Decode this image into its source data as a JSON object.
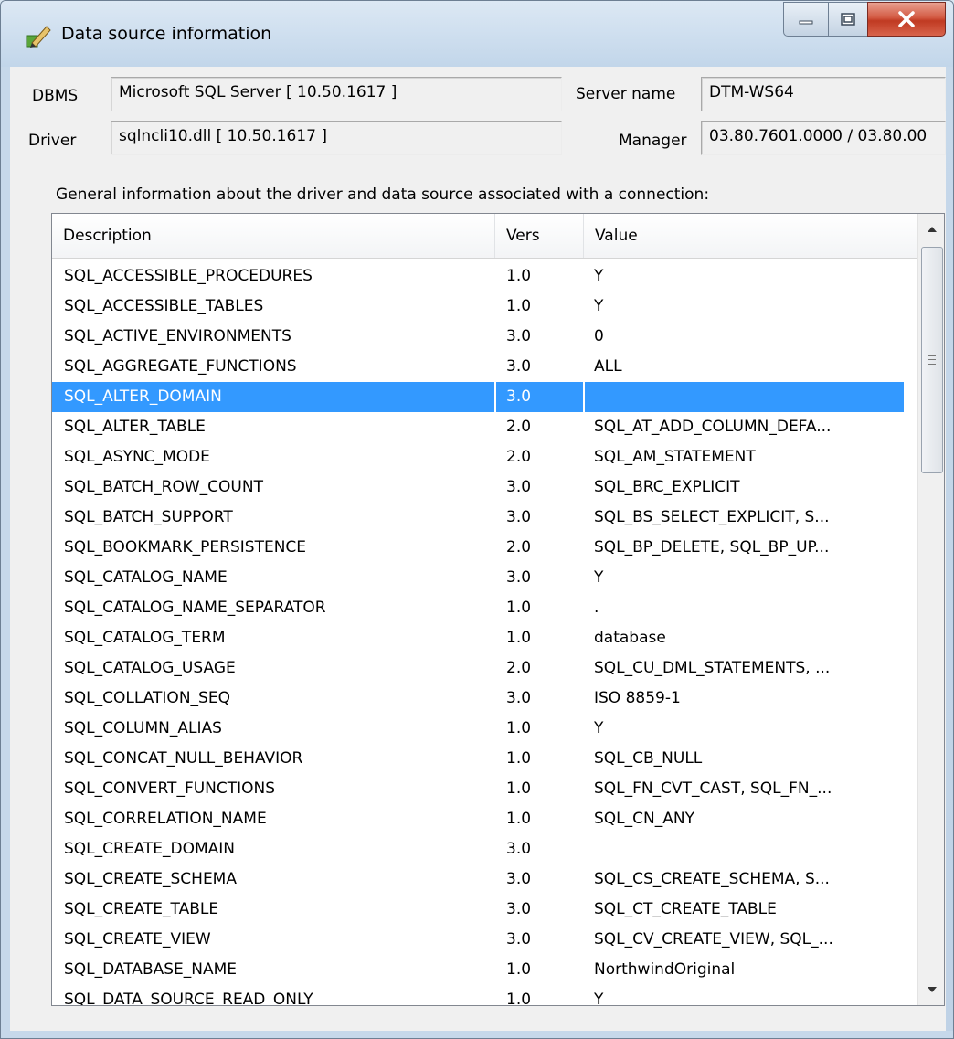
{
  "window": {
    "title": "Data source information",
    "buttons": {
      "minimize": "minimize",
      "maximize": "restore",
      "close": "close"
    }
  },
  "info": {
    "dbms_label": "DBMS",
    "dbms_value": "Microsoft SQL Server [ 10.50.1617 ]",
    "driver_label": "Driver",
    "driver_value": "sqlncli10.dll [ 10.50.1617 ]",
    "server_label": "Server name",
    "server_value": "DTM-WS64",
    "manager_label": "Manager",
    "manager_value": "03.80.7601.0000 / 03.80.00"
  },
  "list": {
    "caption": "General information about the driver and data source associated with a connection:",
    "columns": {
      "description": "Description",
      "vers": "Vers",
      "value": "Value"
    },
    "selected_index": 4,
    "rows": [
      {
        "description": "SQL_ACCESSIBLE_PROCEDURES",
        "vers": "1.0",
        "value": "Y"
      },
      {
        "description": "SQL_ACCESSIBLE_TABLES",
        "vers": "1.0",
        "value": "Y"
      },
      {
        "description": "SQL_ACTIVE_ENVIRONMENTS",
        "vers": "3.0",
        "value": "0"
      },
      {
        "description": "SQL_AGGREGATE_FUNCTIONS",
        "vers": "3.0",
        "value": "ALL"
      },
      {
        "description": "SQL_ALTER_DOMAIN",
        "vers": "3.0",
        "value": ""
      },
      {
        "description": "SQL_ALTER_TABLE",
        "vers": "2.0",
        "value": "SQL_AT_ADD_COLUMN_DEFA..."
      },
      {
        "description": "SQL_ASYNC_MODE",
        "vers": "2.0",
        "value": "SQL_AM_STATEMENT"
      },
      {
        "description": "SQL_BATCH_ROW_COUNT",
        "vers": "3.0",
        "value": "SQL_BRC_EXPLICIT"
      },
      {
        "description": "SQL_BATCH_SUPPORT",
        "vers": "3.0",
        "value": "SQL_BS_SELECT_EXPLICIT, S..."
      },
      {
        "description": "SQL_BOOKMARK_PERSISTENCE",
        "vers": "2.0",
        "value": "SQL_BP_DELETE, SQL_BP_UP..."
      },
      {
        "description": "SQL_CATALOG_NAME",
        "vers": "3.0",
        "value": "Y"
      },
      {
        "description": "SQL_CATALOG_NAME_SEPARATOR",
        "vers": "1.0",
        "value": "."
      },
      {
        "description": "SQL_CATALOG_TERM",
        "vers": "1.0",
        "value": "database"
      },
      {
        "description": "SQL_CATALOG_USAGE",
        "vers": "2.0",
        "value": "SQL_CU_DML_STATEMENTS, ..."
      },
      {
        "description": "SQL_COLLATION_SEQ",
        "vers": "3.0",
        "value": "ISO 8859-1"
      },
      {
        "description": "SQL_COLUMN_ALIAS",
        "vers": "1.0",
        "value": "Y"
      },
      {
        "description": "SQL_CONCAT_NULL_BEHAVIOR",
        "vers": "1.0",
        "value": "SQL_CB_NULL"
      },
      {
        "description": "SQL_CONVERT_FUNCTIONS",
        "vers": "1.0",
        "value": "SQL_FN_CVT_CAST, SQL_FN_..."
      },
      {
        "description": "SQL_CORRELATION_NAME",
        "vers": "1.0",
        "value": "SQL_CN_ANY"
      },
      {
        "description": "SQL_CREATE_DOMAIN",
        "vers": "3.0",
        "value": ""
      },
      {
        "description": "SQL_CREATE_SCHEMA",
        "vers": "3.0",
        "value": "SQL_CS_CREATE_SCHEMA, S..."
      },
      {
        "description": "SQL_CREATE_TABLE",
        "vers": "3.0",
        "value": "SQL_CT_CREATE_TABLE"
      },
      {
        "description": "SQL_CREATE_VIEW",
        "vers": "3.0",
        "value": "SQL_CV_CREATE_VIEW, SQL_..."
      },
      {
        "description": "SQL_DATABASE_NAME",
        "vers": "1.0",
        "value": "NorthwindOriginal"
      },
      {
        "description": "SQL_DATA_SOURCE_READ_ONLY",
        "vers": "1.0",
        "value": "Y"
      }
    ]
  },
  "colors": {
    "selection": "#3399ff",
    "close_button": "#c8452d"
  }
}
